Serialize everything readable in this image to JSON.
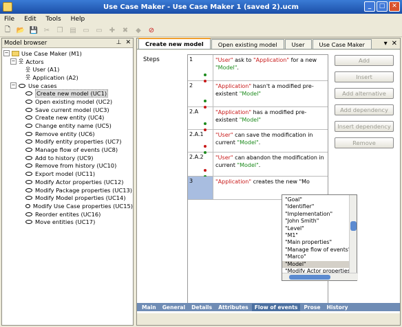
{
  "window": {
    "title": "Use Case Maker - Use Case Maker 1 (saved 2).ucm"
  },
  "menu": [
    "File",
    "Edit",
    "Tools",
    "Help"
  ],
  "toolbar": {
    "icons": [
      "new-icon",
      "open-icon",
      "save-icon",
      "cut-icon",
      "copy-icon",
      "paste-icon",
      "folder-icon",
      "folder-icon",
      "add-icon",
      "remove-icon",
      "tag-icon",
      "delete-icon"
    ]
  },
  "model_browser": {
    "title": "Model browser",
    "root": "Use Case Maker (M1)",
    "actors_label": "Actors",
    "actors": [
      "User (A1)",
      "Application (A2)"
    ],
    "usecases_label": "Use cases",
    "usecases": [
      "Create new model (UC1)",
      "Open existing model (UC2)",
      "Save current model (UC3)",
      "Create new entity (UC4)",
      "Change entity name (UC5)",
      "Remove entity (UC6)",
      "Modify entity properties (UC7)",
      "Manage flow of events (UC8)",
      "Add to history (UC9)",
      "Remove from history (UC10)",
      "Export model (UC11)",
      "Modify Actor properties (UC12)",
      "Modify Package properties (UC13)",
      "Modify Model properties (UC14)",
      "Modify Use Case properties (UC15)",
      "Reorder entites (UC16)",
      "Move entities (UC17)"
    ]
  },
  "tabs": [
    "Create new model",
    "Open existing model",
    "User",
    "Use Case Maker"
  ],
  "steps_label": "Steps",
  "steps": [
    {
      "num": "1",
      "parts": [
        [
          "r",
          "\"User\""
        ],
        [
          "k",
          " ask to "
        ],
        [
          "r",
          "\"Application\""
        ],
        [
          "k",
          " for a new "
        ],
        [
          "g",
          "\"Model\""
        ],
        [
          "k",
          "."
        ]
      ],
      "icon": "green"
    },
    {
      "num": "2",
      "parts": [
        [
          "r",
          "\"Application\""
        ],
        [
          "k",
          " hasn't a modified pre-existent "
        ],
        [
          "g",
          "\"Model\""
        ]
      ],
      "icon": "green"
    },
    {
      "num": "2.A",
      "parts": [
        [
          "r",
          "\"Application\""
        ],
        [
          "k",
          " has a modified pre-existent "
        ],
        [
          "g",
          "\"Model\""
        ]
      ],
      "icon": "green"
    },
    {
      "num": "2.A.1",
      "parts": [
        [
          "r",
          "\"User\""
        ],
        [
          "k",
          " can save the modification in current "
        ],
        [
          "g",
          "\"Model\""
        ],
        [
          "k",
          "."
        ]
      ],
      "icon": "red"
    },
    {
      "num": "2.A.2",
      "parts": [
        [
          "r",
          "\"User\""
        ],
        [
          "k",
          " can abandon the modification in current "
        ],
        [
          "g",
          "\"Model\""
        ],
        [
          "k",
          "."
        ]
      ],
      "icon": "red"
    },
    {
      "num": "3",
      "parts": [
        [
          "r",
          "\"Application\""
        ],
        [
          "k",
          " creates the new \"Mo"
        ]
      ],
      "icon": "none"
    }
  ],
  "buttons": [
    "Add",
    "Insert",
    "Add alternative",
    "Add dependency",
    "Insert dependency",
    "Remove"
  ],
  "autocomplete": [
    "\"Goal\"",
    "\"Identifier\"",
    "\"Implementation\"",
    "\"John Smith\"",
    "\"Level\"",
    "\"M1\"",
    "\"Main properties\"",
    "\"Manage flow of events\"",
    "\"Marco\"",
    "\"Model\"",
    "\"Modify Actor properties\""
  ],
  "autocomplete_selected": "\"Model\"",
  "bottom_tabs": [
    "Main",
    "General",
    "Details",
    "Attributes",
    "Flow of events",
    "Prose",
    "History"
  ],
  "bottom_tab_active": "Flow of events",
  "colors": {
    "actor": "#c81818",
    "entity": "#1c8a1c",
    "titlebar": "#1c4fa8"
  }
}
